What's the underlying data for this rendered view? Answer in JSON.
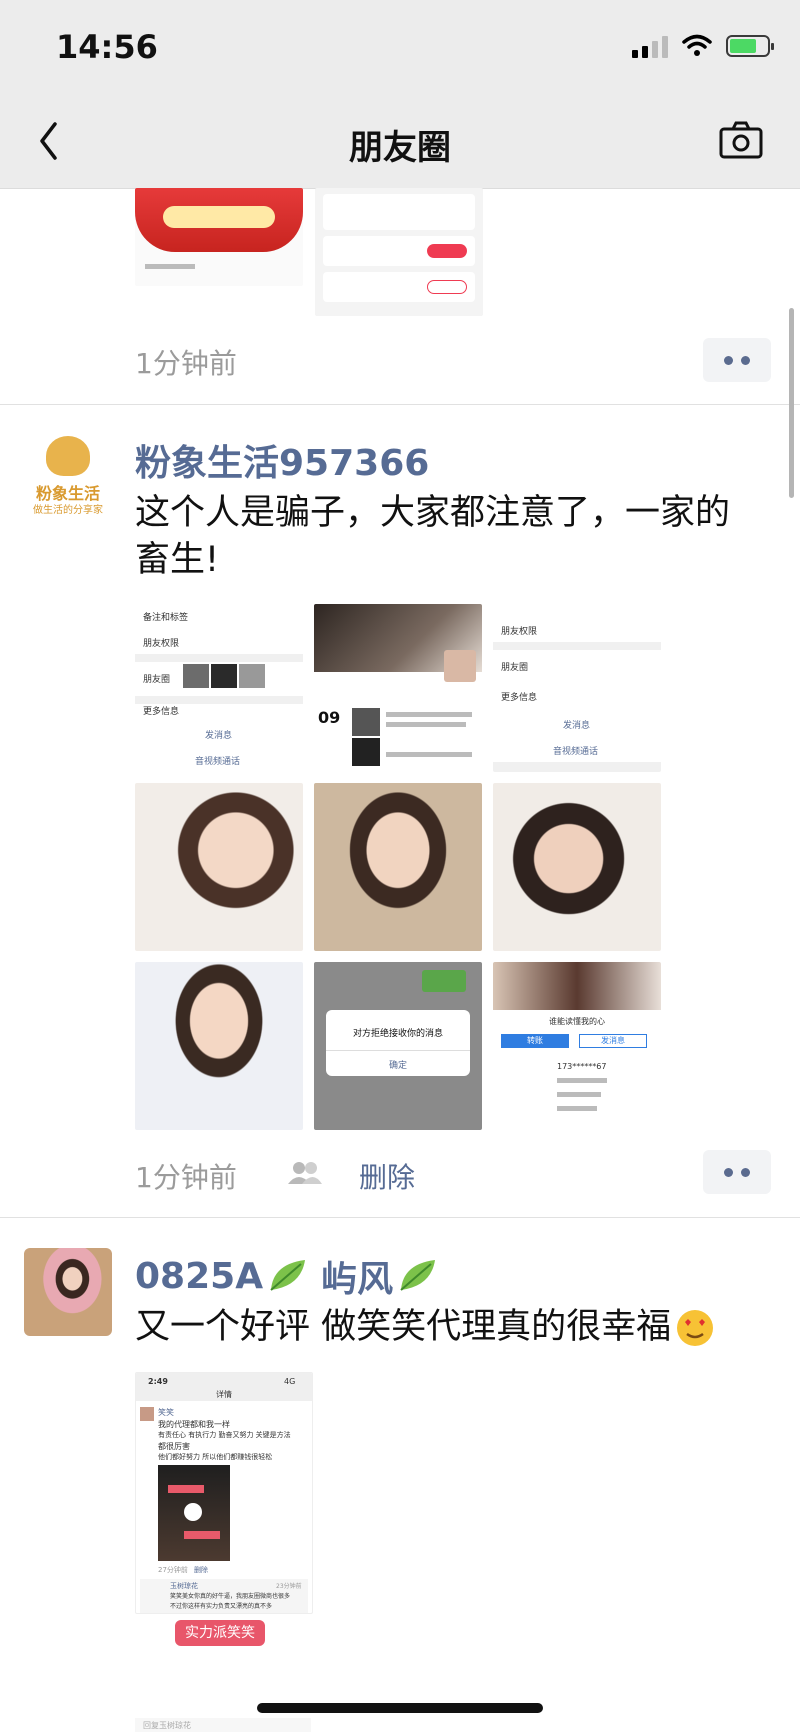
{
  "status": {
    "time": "14:56"
  },
  "nav": {
    "title": "朋友圈"
  },
  "post1": {
    "time": "1分钟前"
  },
  "post2": {
    "user": "粉象生活957366",
    "text_line1": "这个人是骗子，大家都注意了，一家的",
    "text_line2": "畜生!",
    "avatar_brand": "粉象生活",
    "avatar_slogan": "做生活的分享家",
    "time": "1分钟前",
    "delete": "删除",
    "images": [
      {
        "k1": "备注和标签",
        "k2": "朋友权限",
        "k3": "朋友圈",
        "k4": "更多信息",
        "a1": "发消息",
        "a2": "音视频通话"
      },
      {
        "dialog": "对方拒绝接收你的消息",
        "ok": "确定"
      },
      {
        "trans": "转账",
        "send": "发消息",
        "nick": "谁能读懂我的心",
        "phone": "173******67"
      }
    ]
  },
  "post3": {
    "user": "0825A",
    "user2": "屿风",
    "text": "又一个好评 做笑笑代理真的很幸福",
    "shot": {
      "time": "2:49",
      "net": "4G",
      "title": "详情",
      "name": "笑笑",
      "l1": "我的代理都和我一样",
      "l2": "有责任心 有执行力 勤奋又努力 关键是方法",
      "l3": "都很厉害",
      "l4": "他们都好努力 所以他们都赚钱很轻松",
      "ago": "27分钟前",
      "del": "删除",
      "commenter": "玉树琼花",
      "c1": "笑笑美女你真的好牛逼，我朋友圈微商也很多",
      "c2": "不过你这样有实力负责又漂亮的真不多",
      "c_time": "23分钟前",
      "brand": "实力派笑笑",
      "reply": "回复玉树琼花"
    }
  }
}
